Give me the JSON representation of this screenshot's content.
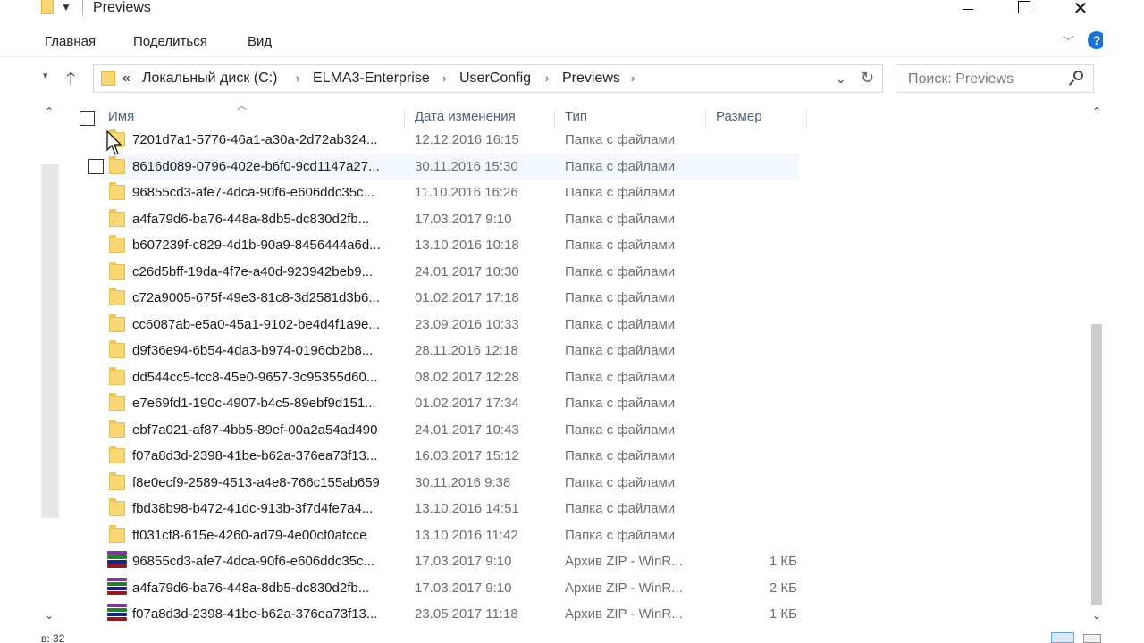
{
  "window": {
    "title": "Previews",
    "minimize_icon": "minimize-icon",
    "maximize_icon": "maximize-icon",
    "close_icon": "close-icon"
  },
  "ribbon": {
    "tabs": [
      "Главная",
      "Поделиться",
      "Вид"
    ],
    "help_label": "?"
  },
  "address": {
    "overflow": "«",
    "crumbs": [
      "Локальный диск (C:)",
      "ELMA3-Enterprise",
      "UserConfig",
      "Previews"
    ]
  },
  "search": {
    "placeholder": "Поиск: Previews"
  },
  "columns": {
    "name": "Имя",
    "date": "Дата изменения",
    "type": "Тип",
    "size": "Размер"
  },
  "files": [
    {
      "name": "7201d7a1-5776-46a1-a30a-2d72ab324...",
      "date": "12.12.2016 16:15",
      "type": "Папка с файлами",
      "size": "",
      "kind": "folder"
    },
    {
      "name": "8616d089-0796-402e-b6f0-9cd1147a27...",
      "date": "30.11.2016 15:30",
      "type": "Папка с файлами",
      "size": "",
      "kind": "folder"
    },
    {
      "name": "96855cd3-afe7-4dca-90f6-e606ddc35c...",
      "date": "11.10.2016 16:26",
      "type": "Папка с файлами",
      "size": "",
      "kind": "folder"
    },
    {
      "name": "a4fa79d6-ba76-448a-8db5-dc830d2fb...",
      "date": "17.03.2017 9:10",
      "type": "Папка с файлами",
      "size": "",
      "kind": "folder"
    },
    {
      "name": "b607239f-c829-4d1b-90a9-8456444a6d...",
      "date": "13.10.2016 10:18",
      "type": "Папка с файлами",
      "size": "",
      "kind": "folder"
    },
    {
      "name": "c26d5bff-19da-4f7e-a40d-923942beb9...",
      "date": "24.01.2017 10:30",
      "type": "Папка с файлами",
      "size": "",
      "kind": "folder"
    },
    {
      "name": "c72a9005-675f-49e3-81c8-3d2581d3b6...",
      "date": "01.02.2017 17:18",
      "type": "Папка с файлами",
      "size": "",
      "kind": "folder"
    },
    {
      "name": "cc6087ab-e5a0-45a1-9102-be4d4f1a9e...",
      "date": "23.09.2016 10:33",
      "type": "Папка с файлами",
      "size": "",
      "kind": "folder"
    },
    {
      "name": "d9f36e94-6b54-4da3-b974-0196cb2b8...",
      "date": "28.11.2016 12:18",
      "type": "Папка с файлами",
      "size": "",
      "kind": "folder"
    },
    {
      "name": "dd544cc5-fcc8-45e0-9657-3c95355d60...",
      "date": "08.02.2017 12:28",
      "type": "Папка с файлами",
      "size": "",
      "kind": "folder"
    },
    {
      "name": "e7e69fd1-190c-4907-b4c5-89ebf9d151...",
      "date": "01.02.2017 17:34",
      "type": "Папка с файлами",
      "size": "",
      "kind": "folder"
    },
    {
      "name": "ebf7a021-af87-4bb5-89ef-00a2a54ad490",
      "date": "24.01.2017 10:43",
      "type": "Папка с файлами",
      "size": "",
      "kind": "folder"
    },
    {
      "name": "f07a8d3d-2398-41be-b62a-376ea73f13...",
      "date": "16.03.2017 15:12",
      "type": "Папка с файлами",
      "size": "",
      "kind": "folder"
    },
    {
      "name": "f8e0ecf9-2589-4513-a4e8-766c155ab659",
      "date": "30.11.2016 9:38",
      "type": "Папка с файлами",
      "size": "",
      "kind": "folder"
    },
    {
      "name": "fbd38b98-b472-41dc-913b-3f7d4fe7a4...",
      "date": "13.10.2016 14:51",
      "type": "Папка с файлами",
      "size": "",
      "kind": "folder"
    },
    {
      "name": "ff031cf8-615e-4260-ad79-4e00cf0afcce",
      "date": "13.10.2016 11:42",
      "type": "Папка с файлами",
      "size": "",
      "kind": "folder"
    },
    {
      "name": "96855cd3-afe7-4dca-90f6-e606ddc35c...",
      "date": "17.03.2017 9:10",
      "type": "Архив ZIP - WinR...",
      "size": "1 КБ",
      "kind": "zip"
    },
    {
      "name": "a4fa79d6-ba76-448a-8db5-dc830d2fb...",
      "date": "17.03.2017 9:10",
      "type": "Архив ZIP - WinR...",
      "size": "2 КБ",
      "kind": "zip"
    },
    {
      "name": "f07a8d3d-2398-41be-b62a-376ea73f13...",
      "date": "23.05.2017 11:18",
      "type": "Архив ZIP - WinR...",
      "size": "1 КБ",
      "kind": "zip"
    }
  ],
  "status": {
    "count": "в: 32"
  },
  "colors": {
    "folder": "#f8d775",
    "header_text": "#4c607a",
    "secondary_text": "#6d6d6d",
    "accent": "#1b72d6"
  }
}
